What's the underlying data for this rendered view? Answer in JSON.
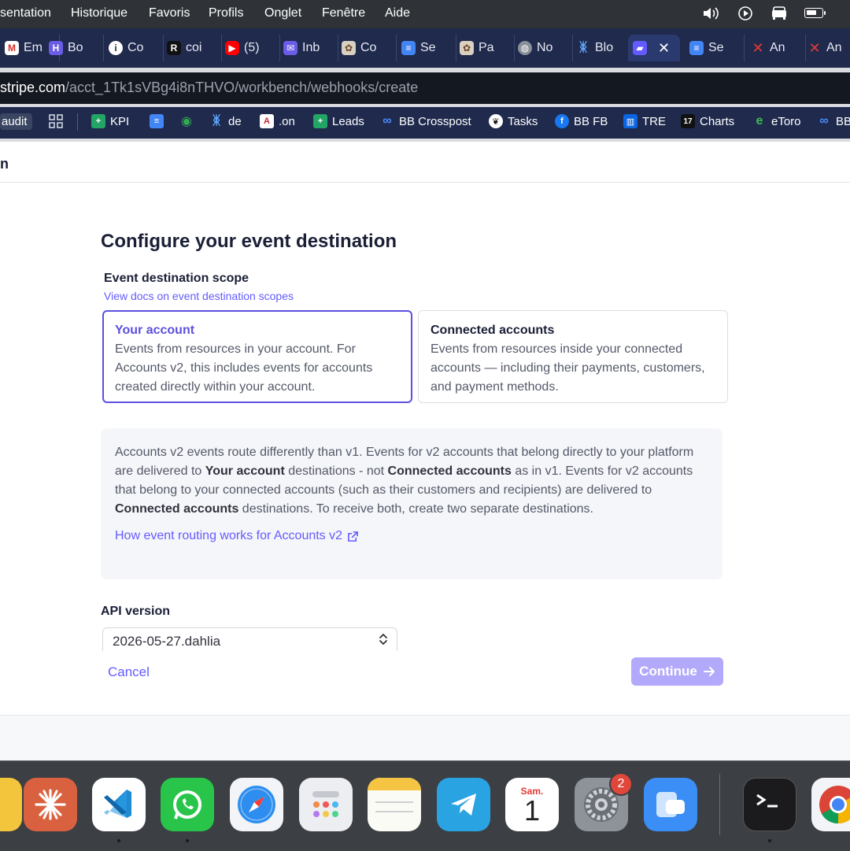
{
  "menubar": {
    "items": [
      "sentation",
      "Historique",
      "Favoris",
      "Profils",
      "Onglet",
      "Fenêtre",
      "Aide"
    ]
  },
  "tabs": [
    {
      "label": "Em",
      "icon": "gmail-icon",
      "color": "#ffffff"
    },
    {
      "label": "Bo",
      "icon": "board-icon",
      "color": "#6b5ce7"
    },
    {
      "label": "Co",
      "icon": "info-icon",
      "color": "#ffffff"
    },
    {
      "label": "coi",
      "icon": "r-logo-icon",
      "color": "#111111"
    },
    {
      "label": "(5)",
      "icon": "youtube-icon",
      "color": "#ff0000"
    },
    {
      "label": "Inb",
      "icon": "mail-icon",
      "color": "#6b5ce7"
    },
    {
      "label": "Co",
      "icon": "document-icon",
      "color": "#d9d0c0"
    },
    {
      "label": "Se",
      "icon": "google-docs-icon",
      "color": "#4285f4"
    },
    {
      "label": "Pa",
      "icon": "document-icon",
      "color": "#d9d0c0"
    },
    {
      "label": "No",
      "icon": "globe-icon",
      "color": "#8a8f99"
    },
    {
      "label": "Blo",
      "icon": "butterfly-icon",
      "color": "#3b82f6"
    },
    {
      "label": "",
      "icon": "stripe-workbench-icon",
      "color": "#635bff",
      "active": true
    },
    {
      "label": "Se",
      "icon": "google-docs-icon",
      "color": "#4285f4"
    },
    {
      "label": "An",
      "icon": "close-x-icon",
      "color": "#e53935"
    },
    {
      "label": "An",
      "icon": "close-x-icon",
      "color": "#e53935"
    }
  ],
  "address": {
    "host": "stripe.com",
    "path": "/acct_1Tk1sVBg4i8nTHVO/workbench/webhooks/create"
  },
  "bookmarks": [
    {
      "label": "audit",
      "icon": ""
    },
    {
      "label": "",
      "icon": "apps-grid-icon"
    },
    {
      "label": "KPI",
      "icon": "sheet-icon"
    },
    {
      "label": "",
      "icon": "google-docs-icon"
    },
    {
      "label": "",
      "icon": "maps-pin-icon"
    },
    {
      "label": "de",
      "icon": "butterfly-icon"
    },
    {
      "label": ".on",
      "icon": "a-icon"
    },
    {
      "label": "Leads",
      "icon": "sheet-icon"
    },
    {
      "label": "BB Crosspost",
      "icon": "meta-icon"
    },
    {
      "label": "Tasks",
      "icon": "wreath-icon"
    },
    {
      "label": "BB FB",
      "icon": "facebook-icon"
    },
    {
      "label": "TRE",
      "icon": "trello-icon"
    },
    {
      "label": "Charts",
      "icon": "tradingview-icon"
    },
    {
      "label": "eToro",
      "icon": "etoro-icon"
    },
    {
      "label": "BB",
      "icon": "meta-icon"
    }
  ],
  "page": {
    "header_fragment": "n",
    "title": "Configure your event destination",
    "scope": {
      "label": "Event destination scope",
      "docs_link": "View docs on event destination scopes",
      "options": [
        {
          "title": "Your account",
          "description": "Events from resources in your account. For Accounts v2, this includes events for accounts created directly within your account.",
          "selected": true
        },
        {
          "title": "Connected accounts",
          "description": "Events from resources inside your connected accounts — including their payments, customers, and payment methods.",
          "selected": false
        }
      ]
    },
    "info": {
      "t1": "Accounts v2 events route differently than v1. Events for v2 accounts that belong directly to your platform are delivered to ",
      "b1": "Your account",
      "t2": " destinations - not ",
      "b2": "Connected accounts",
      "t3": " as in v1. Events for v2 accounts that belong to your connected accounts (such as their customers and recipients) are delivered to ",
      "b3": "Connected accounts",
      "t4": " destinations. To receive both, create two separate destinations.",
      "link": "How event routing works for Accounts v2"
    },
    "api_version": {
      "label": "API version",
      "value": "2026-05-27.dahlia"
    },
    "cancel_label": "Cancel",
    "continue_label": "Continue"
  },
  "dock": {
    "apps": [
      "notes-app-icon",
      "claude-icon",
      "vscode-icon",
      "whatsapp-icon",
      "safari-icon",
      "launchpad-icon",
      "notes-icon",
      "telegram-icon",
      "calendar-icon",
      "system-settings-icon",
      "screens-icon",
      "terminal-icon",
      "chrome-icon"
    ],
    "calendar_day_label": "Sam.",
    "calendar_day_number": "1",
    "settings_badge": "2"
  },
  "colors": {
    "accent": "#635bff",
    "selected_border": "#5b4fe0",
    "continue_disabled": "#b3a9fb",
    "tab_bar": "#1f2a4d"
  }
}
